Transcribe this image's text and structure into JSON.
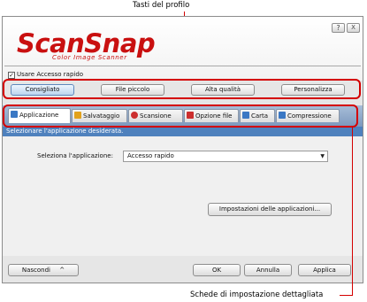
{
  "annotations": {
    "top_callout": "Tasti del profilo",
    "bottom_callout": "Schede di impostazione dettagliata"
  },
  "window": {
    "help_button": "?",
    "close_button": "X",
    "logo_main": "ScanSnap",
    "logo_sub": "Color Image Scanner"
  },
  "quick_access": {
    "label": "Usare Accesso rapido",
    "checked": true,
    "check_mark": "✓"
  },
  "profiles": {
    "buttons": [
      "Consigliato",
      "File piccolo",
      "Alta qualità",
      "Personalizza"
    ],
    "selected_index": 0
  },
  "tabs": {
    "items": [
      "Applicazione",
      "Salvataggio",
      "Scansione",
      "Opzione file",
      "Carta",
      "Compressione"
    ],
    "active_index": 0,
    "icon_colors": [
      "#3b78c4",
      "#e2a21c",
      "#cc2f2f",
      "#cc2f2f",
      "#3b78c4",
      "#3b78c4"
    ]
  },
  "content": {
    "section_title": "Selezionare l'applicazione desiderata.",
    "select_label": "Seleziona l'applicazione:",
    "select_value": "Accesso rapido",
    "app_settings_button": "Impostazioni delle applicazioni..."
  },
  "footer": {
    "hide_button": "Nascondi",
    "hide_arrow": "^",
    "ok_button": "OK",
    "cancel_button": "Annulla",
    "apply_button": "Applica"
  },
  "colors": {
    "callout_red": "#d40000",
    "logo_red": "#c91010",
    "tab_strip": "#7c98bd",
    "section_bar": "#4f81bd"
  }
}
